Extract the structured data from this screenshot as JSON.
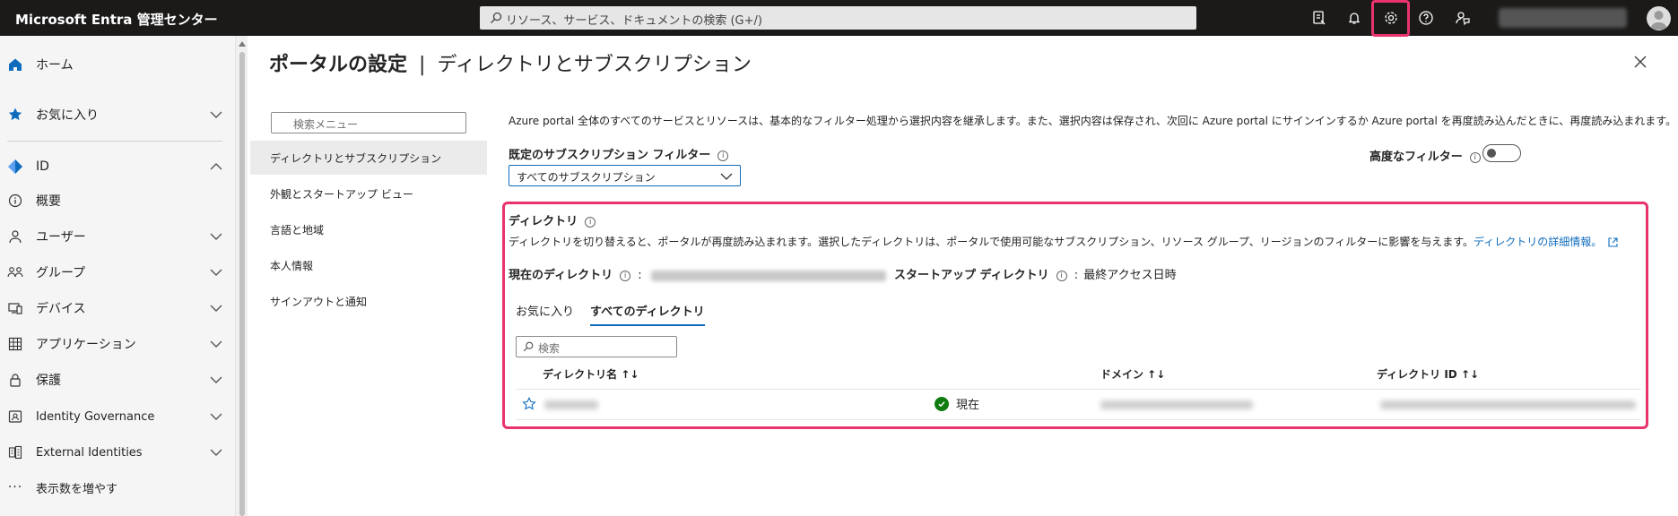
{
  "app": {
    "title": "Microsoft Entra 管理センター"
  },
  "topbar": {
    "search_placeholder": "リソース、サービス、ドキュメントの検索 (G+/)",
    "icons": [
      "feedback-copilot-icon",
      "bell-icon",
      "gear-icon",
      "help-icon",
      "feedback-icon"
    ]
  },
  "sidebar": {
    "items": [
      {
        "label": "ホーム",
        "icon": "home-icon"
      },
      {
        "label": "お気に入り",
        "icon": "star-icon"
      },
      {
        "label": "ID",
        "icon": "diamond-icon"
      },
      {
        "label": "概要",
        "icon": "info-icon"
      },
      {
        "label": "ユーザー",
        "icon": "user-icon"
      },
      {
        "label": "グループ",
        "icon": "group-icon"
      },
      {
        "label": "デバイス",
        "icon": "device-icon"
      },
      {
        "label": "アプリケーション",
        "icon": "apps-icon"
      },
      {
        "label": "保護",
        "icon": "lock-icon"
      },
      {
        "label": "Identity Governance",
        "icon": "governance-icon"
      },
      {
        "label": "External Identities",
        "icon": "external-icon"
      },
      {
        "label": "表示数を増やす",
        "icon": "more-icon"
      }
    ]
  },
  "page": {
    "title_bold": "ポータルの設定",
    "title_sep": "|",
    "title_rest": "ディレクトリとサブスクリプション"
  },
  "submenu": {
    "search_placeholder": "検索メニュー",
    "items": [
      "ディレクトリとサブスクリプション",
      "外観とスタートアップ ビュー",
      "言語と地域",
      "本人情報",
      "サインアウトと通知"
    ]
  },
  "main": {
    "description": "Azure portal 全体のすべてのサービスとリソースは、基本的なフィルター処理から選択内容を継承します。また、選択内容は保存され、次回に Azure portal にサインインするか Azure portal を再度読み込んだときに、再度読み込まれます。",
    "default_filter_label": "既定のサブスクリプション フィルター",
    "default_filter_value": "すべてのサブスクリプション",
    "advanced_filter_label": "高度なフィルター",
    "advanced_filter_on": false
  },
  "directory": {
    "heading": "ディレクトリ",
    "description": "ディレクトリを切り替えると、ポータルが再度読み込まれます。選択したディレクトリは、ポータルで使用可能なサブスクリプション、リソース グループ、リージョンのフィルターに影響を与えます。",
    "learn_more_link": "ディレクトリの詳細情報。",
    "current_label": "現在のディレクトリ",
    "startup_label": "スタートアップ ディレクトリ",
    "startup_value": "最終アクセス日時",
    "colon": ":",
    "tabs": [
      "お気に入り",
      "すべてのディレクトリ"
    ],
    "active_tab": 1,
    "search_placeholder": "検索",
    "columns": [
      "ディレクトリ名 ↑↓",
      "ドメイン ↑↓",
      "ディレクトリ ID ↑↓"
    ],
    "row_status": "現在"
  },
  "colors": {
    "topbar_bg": "#1b1a19",
    "highlight": "#e8336c",
    "accent": "#0f6cbd",
    "success": "#107c10"
  }
}
